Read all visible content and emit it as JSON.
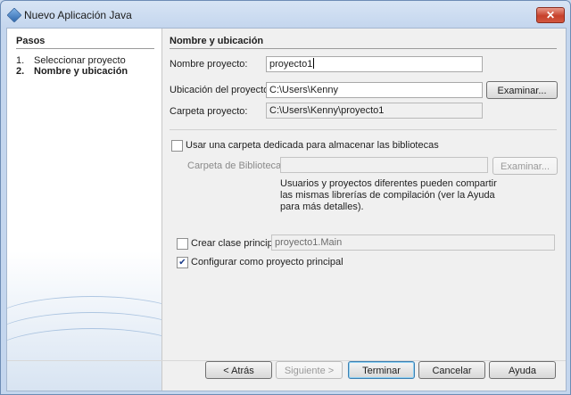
{
  "window": {
    "title": "Nuevo  Aplicación Java",
    "close_label": "✕"
  },
  "steps": {
    "title": "Pasos",
    "items": [
      {
        "num": "1.",
        "label": "Seleccionar proyecto"
      },
      {
        "num": "2.",
        "label": "Nombre y ubicación"
      }
    ]
  },
  "panel": {
    "title": "Nombre y ubicación",
    "project_name": {
      "label": "Nombre proyecto:",
      "value": "proyecto1"
    },
    "project_location": {
      "label": "Ubicación del proyecto:",
      "value": "C:\\Users\\Kenny",
      "browse_label": "Examinar..."
    },
    "project_folder": {
      "label": "Carpeta proyecto:",
      "value": "C:\\Users\\Kenny\\proyecto1"
    },
    "dedicated_folder": {
      "label": "Usar una carpeta dedicada para almacenar las bibliotecas",
      "checked": false
    },
    "libraries_folder": {
      "label": "Carpeta de Bibliotecas:",
      "value": "",
      "browse_label": "Examinar..."
    },
    "help_text": "Usuarios y proyectos diferentes pueden compartir las mismas librerías de compilación (ver la Ayuda para más detalles).",
    "main_class": {
      "label": "Crear clase principal",
      "checked": false,
      "value": "proyecto1.Main"
    },
    "set_main_project": {
      "label": "Configurar como proyecto principal",
      "checked": true
    }
  },
  "buttons": {
    "back": "< Atrás",
    "next": "Siguiente >",
    "finish": "Terminar",
    "cancel": "Cancelar",
    "help": "Ayuda"
  }
}
